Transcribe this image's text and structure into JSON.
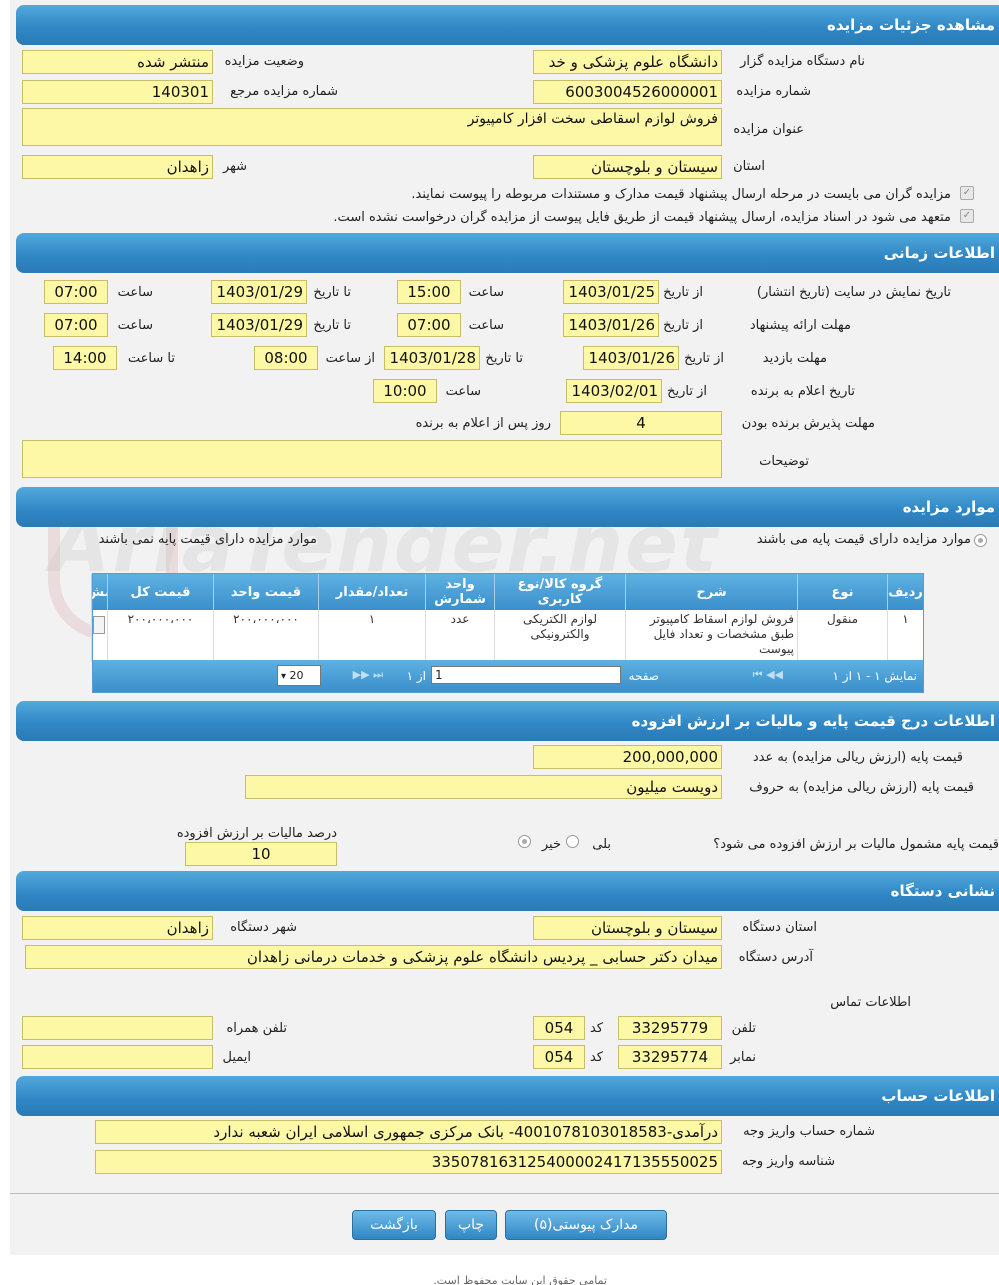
{
  "sections": {
    "details": "مشاهده جزئیات مزایده",
    "time": "اطلاعات زمانی",
    "items": "موارد مزایده",
    "price": "اطلاعات درج قیمت پایه و مالیات بر ارزش افزوده",
    "address": "نشانی دستگاه",
    "account": "اطلاعات حساب"
  },
  "details": {
    "org_label": "نام دستگاه مزایده گزار",
    "org_value": "دانشگاه علوم پزشکی و خد",
    "status_label": "وضعیت مزایده",
    "status_value": "منتشر شده",
    "number_label": "شماره مزایده",
    "number_value": "6003004526000001",
    "ref_label": "شماره مزایده مرجع",
    "ref_value": "140301",
    "title_label": "عنوان مزایده",
    "title_value": "فروش لوازم اسقاطی سخت افزار کامپیوتر",
    "province_label": "استان",
    "province_value": "سیستان و بلوچستان",
    "city_label": "شهر",
    "city_value": "زاهدان",
    "check1": "مزایده گران می بایست در مرحله ارسال پیشنهاد قیمت مدارک و مستندات مربوطه را پیوست نمایند.",
    "check2": "متعهد می شود در اسناد مزایده، ارسال پیشنهاد قیمت از طریق فایل پیوست از مزایده گران درخواست نشده است."
  },
  "time": {
    "r1_label": "تاریخ نمایش در سایت (تاریخ انتشار)",
    "r2_label": "مهلت ارائه پیشنهاد",
    "r3_label": "مهلت بازدید",
    "r4_label": "تاریخ اعلام به برنده",
    "r5_label": "مهلت پذیرش برنده بودن",
    "from_date": "از تاریخ",
    "to_date": "تا تاریخ",
    "hour": "ساعت",
    "from_hour": "از ساعت",
    "to_hour": "تا ساعت",
    "r1_from": "1403/01/25",
    "r1_from_time": "15:00",
    "r1_to": "1403/01/29",
    "r1_to_time": "07:00",
    "r2_from": "1403/01/26",
    "r2_from_time": "07:00",
    "r2_to": "1403/01/29",
    "r2_to_time": "07:00",
    "r3_from": "1403/01/26",
    "r3_to": "1403/01/28",
    "r3_from_hour": "08:00",
    "r3_to_hour": "14:00",
    "r4_from": "1403/02/01",
    "r4_time": "10:00",
    "r5_days": "4",
    "r5_suffix": "روز پس از اعلام به برنده",
    "desc_label": "توضیحات"
  },
  "items": {
    "radio_has_base": "موارد مزایده دارای قیمت پایه می باشند",
    "radio_no_base": "موارد مزایده دارای قیمت پایه نمی باشند",
    "columns": [
      "ردیف",
      "نوع",
      "شرح",
      "گروه کالا/نوع کاربری",
      "واحد شمارش",
      "تعداد/مقدار",
      "قیمت واحد",
      "قیمت کل",
      "مش"
    ],
    "row": [
      "۱",
      "منقول",
      "فروش لوازم اسقاط کامپیوتر طبق مشخصات و تعداد فایل پیوست",
      "لوازم الکتریکی والکترونیکی",
      "عدد",
      "۱",
      "۲۰۰،۰۰۰،۰۰۰",
      "۲۰۰،۰۰۰،۰۰۰"
    ],
    "pager_summary": "نمایش ۱ - ۱ از ۱",
    "pager_page": "صفحه",
    "pager_page_value": "1",
    "pager_of": "از ۱",
    "pager_size": "20"
  },
  "price": {
    "base_num_label": "قیمت پایه (ارزش ریالی مزایده) به عدد",
    "base_num_value": "200,000,000",
    "base_text_label": "قیمت پایه (ارزش ریالی مزایده) به حروف",
    "base_text_value": "دویست میلیون",
    "vat_question": "قیمت پایه مشمول مالیات بر ارزش افزوده می شود؟",
    "yes": "بلی",
    "no": "خیر",
    "vat_percent_label": "درصد مالیات بر ارزش افزوده",
    "vat_percent_value": "10"
  },
  "address": {
    "province_label": "استان دستگاه",
    "province_value": "سیستان و بلوچستان",
    "city_label": "شهر دستگاه",
    "city_value": "زاهدان",
    "addr_label": "آدرس دستگاه",
    "addr_value": "میدان دکتر حسابی _ پردیس دانشگاه علوم پزشکی و خدمات درمانی زاهدان",
    "contact_label": "اطلاعات تماس",
    "phone_label": "تلفن",
    "phone_value": "33295779",
    "code_label": "کد",
    "phone_code": "054",
    "mobile_label": "تلفن همراه",
    "mobile_value": "",
    "fax_label": "نمابر",
    "fax_value": "33295774",
    "fax_code": "054",
    "email_label": "ایمیل",
    "email_value": ""
  },
  "account": {
    "acc_label": "شماره حساب واریز وجه",
    "acc_value": "درآمدی-4001078103018583- بانک مرکزی جمهوری اسلامی ایران شعبه ندارد",
    "id_label": "شناسه واریز وجه",
    "id_value": "335078163125400002417135550025"
  },
  "buttons": {
    "attachments": "مدارک پیوستی(۵)",
    "print": "چاپ",
    "back": "بازگشت"
  },
  "footer": "تمامی حقوق این سایت محفوظ است."
}
